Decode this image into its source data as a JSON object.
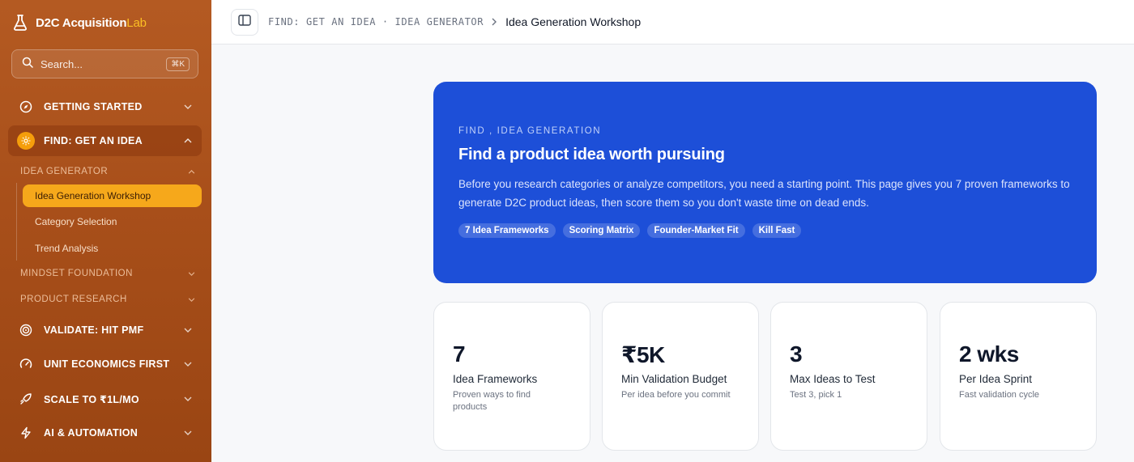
{
  "brand": {
    "name": "D2C Acquisition",
    "accent": "Lab"
  },
  "search": {
    "label": "Search...",
    "shortcut": "⌘K"
  },
  "nav": {
    "getting_started": "GETTING STARTED",
    "find": "FIND: GET AN IDEA",
    "idea_generator": "IDEA GENERATOR",
    "items": [
      "Idea Generation Workshop",
      "Category Selection",
      "Trend Analysis"
    ],
    "mindset": "MINDSET FOUNDATION",
    "product_research": "PRODUCT RESEARCH",
    "validate": "VALIDATE: HIT PMF",
    "unit_economics": "UNIT ECONOMICS FIRST",
    "scale": "SCALE TO ₹1L/MO",
    "ai": "AI & AUTOMATION"
  },
  "breadcrumb": {
    "section": "FIND: GET AN IDEA",
    "separator_dot": "·",
    "subsection": "IDEA GENERATOR",
    "current": "Idea Generation Workshop"
  },
  "hero": {
    "eyebrow": "FIND , IDEA GENERATION",
    "title": "Find a product idea worth pursuing",
    "description": "Before you research categories or analyze competitors, you need a starting point. This page gives you 7 proven frameworks to generate D2C product ideas, then score them so you don't waste time on dead ends.",
    "tags": [
      "7 Idea Frameworks",
      "Scoring Matrix",
      "Founder-Market Fit",
      "Kill Fast"
    ]
  },
  "stats": [
    {
      "value": "7",
      "label": "Idea Frameworks",
      "sub": "Proven ways to find products"
    },
    {
      "value": "₹5K",
      "label": "Min Validation Budget",
      "sub": "Per idea before you commit"
    },
    {
      "value": "3",
      "label": "Max Ideas to Test",
      "sub": "Test 3, pick 1"
    },
    {
      "value": "2 wks",
      "label": "Per Idea Sprint",
      "sub": "Fast validation cycle"
    }
  ],
  "colors": {
    "sidebar": "#a84f1a",
    "accent": "#f6a81b",
    "hero": "#1d4fd8"
  }
}
